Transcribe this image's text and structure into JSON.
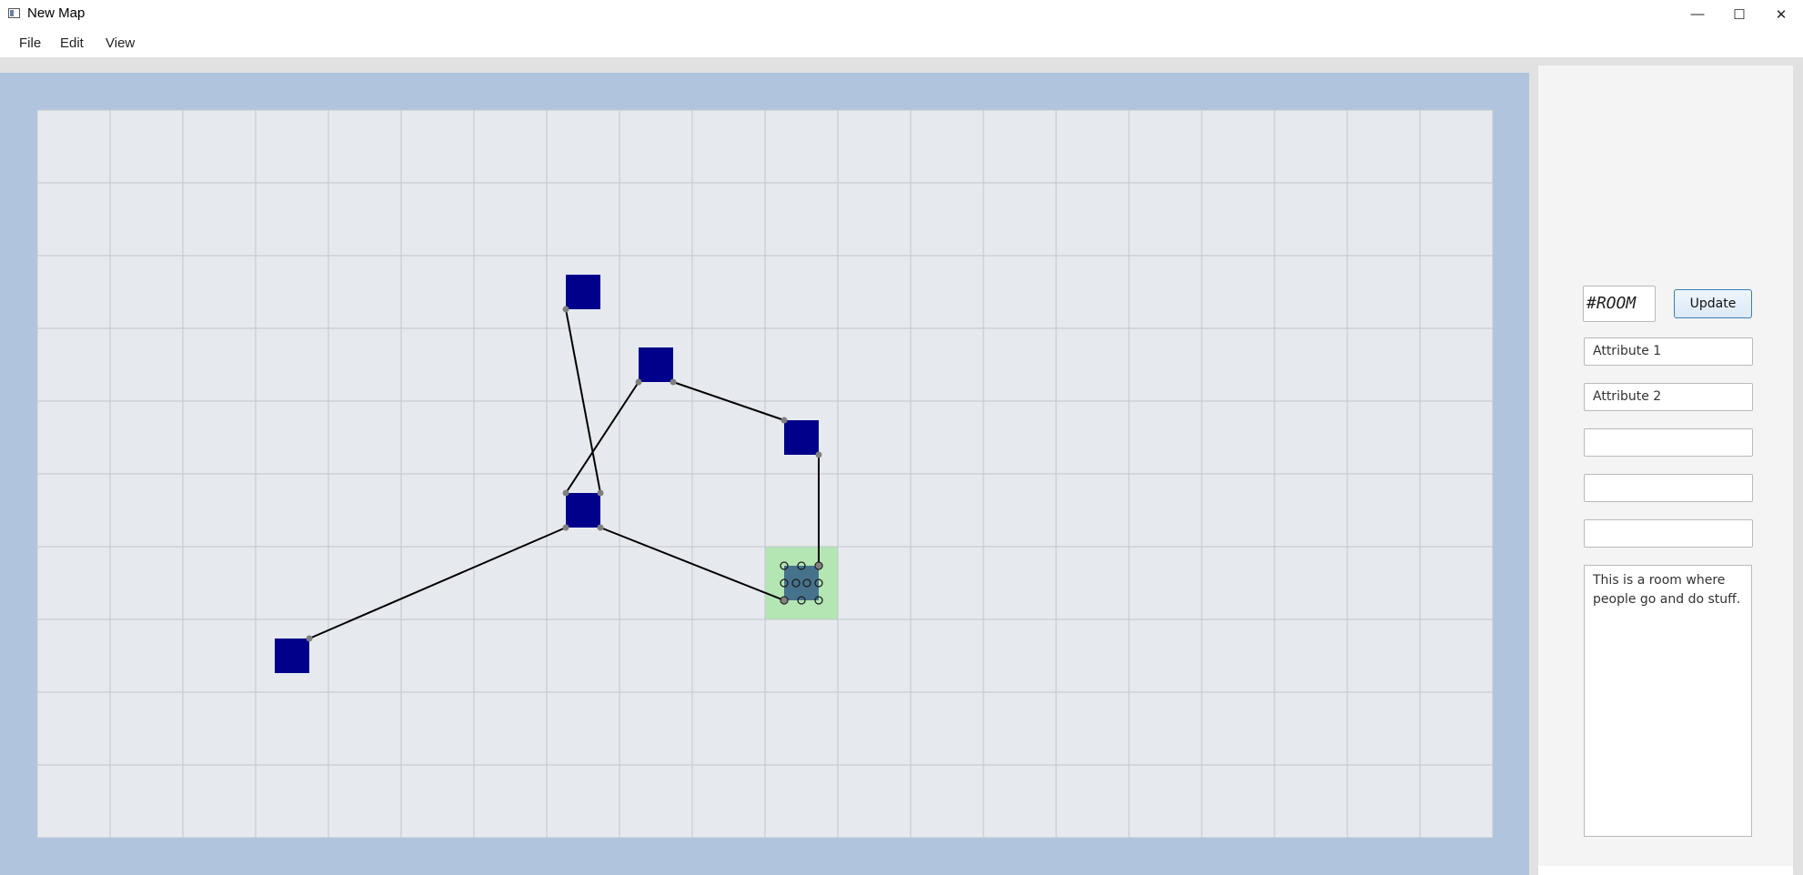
{
  "window": {
    "title": "New Map",
    "controls": {
      "minimize": "—",
      "maximize": "☐",
      "close": "✕"
    }
  },
  "menu": {
    "file": "File",
    "edit": "Edit",
    "view": "View"
  },
  "colors": {
    "canvas_border": "#b0c4de",
    "grid_fill": "#e6e9ed",
    "grid_line": "#c2c7cf",
    "room": "#00008b",
    "selected_room": "#46728c",
    "selected_cell": "#b4e6b4",
    "connector": "#000000",
    "handle": "#808080"
  },
  "map": {
    "grid": {
      "columns": 20,
      "rows": 10
    },
    "rooms": [
      {
        "id": "room-1",
        "col": 7,
        "row": 2,
        "selected": false
      },
      {
        "id": "room-2",
        "col": 8,
        "row": 3,
        "selected": false
      },
      {
        "id": "room-3",
        "col": 10,
        "row": 4,
        "selected": false
      },
      {
        "id": "room-4",
        "col": 7,
        "row": 5,
        "selected": false
      },
      {
        "id": "room-5",
        "col": 10,
        "row": 6,
        "selected": true
      },
      {
        "id": "room-6",
        "col": 3,
        "row": 7,
        "selected": false
      }
    ],
    "connections": [
      {
        "from": "room-1",
        "from_corner": "bl",
        "to": "room-4",
        "to_corner": "tr"
      },
      {
        "from": "room-2",
        "from_corner": "bl",
        "to": "room-4",
        "to_corner": "tl"
      },
      {
        "from": "room-2",
        "from_corner": "br",
        "to": "room-3",
        "to_corner": "tl"
      },
      {
        "from": "room-3",
        "from_corner": "br",
        "to": "room-5",
        "to_corner": "tr"
      },
      {
        "from": "room-4",
        "from_corner": "br",
        "to": "room-5",
        "to_corner": "bl"
      },
      {
        "from": "room-4",
        "from_corner": "bl",
        "to": "room-6",
        "to_corner": "tr"
      }
    ]
  },
  "panel": {
    "room_id": "#ROOM",
    "update_label": "Update",
    "attributes": [
      "Attribute 1",
      "Attribute 2",
      "",
      "",
      ""
    ],
    "description": "This is a room where people go and do stuff."
  }
}
